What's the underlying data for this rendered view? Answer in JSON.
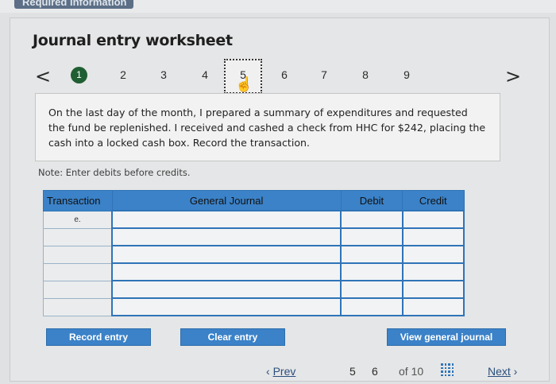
{
  "header": {
    "tab_label": "Required information"
  },
  "worksheet": {
    "title": "Journal entry worksheet",
    "steps": [
      "1",
      "2",
      "3",
      "4",
      "5",
      "6",
      "7",
      "8",
      "9"
    ],
    "active_step": "1",
    "current_step": "5",
    "prev_arrow": "<",
    "next_arrow": ">"
  },
  "question": {
    "text": "On the last day of the month, I prepared a summary of expenditures and requested the fund be replenished. I received and cashed a check from HHC for $242, placing the cash into a locked cash box. Record the transaction."
  },
  "note": "Note: Enter debits before credits.",
  "table": {
    "headers": {
      "transaction": "Transaction",
      "general_journal": "General Journal",
      "debit": "Debit",
      "credit": "Credit"
    },
    "rows": [
      {
        "transaction": "e.",
        "journal": "",
        "debit": "",
        "credit": ""
      },
      {
        "transaction": "",
        "journal": "",
        "debit": "",
        "credit": ""
      },
      {
        "transaction": "",
        "journal": "",
        "debit": "",
        "credit": ""
      },
      {
        "transaction": "",
        "journal": "",
        "debit": "",
        "credit": ""
      },
      {
        "transaction": "",
        "journal": "",
        "debit": "",
        "credit": ""
      },
      {
        "transaction": "",
        "journal": "",
        "debit": "",
        "credit": ""
      }
    ]
  },
  "buttons": {
    "record_entry": "Record entry",
    "clear_entry": "Clear entry",
    "view_general_journal": "View general journal"
  },
  "footer": {
    "prev": "Prev",
    "page_current_a": "5",
    "page_current_b": "6",
    "of": "of 10",
    "next": "Next"
  }
}
